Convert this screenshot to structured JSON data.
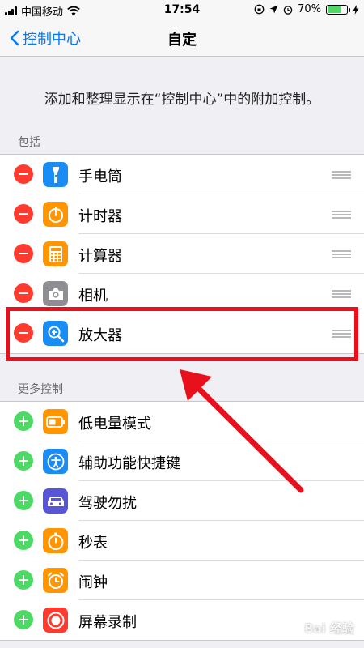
{
  "status_bar": {
    "carrier": "中国移动",
    "time": "17:54",
    "battery_percent": "70%",
    "battery_level": 0.7
  },
  "nav": {
    "back_label": "控制中心",
    "title": "自定"
  },
  "description": "添加和整理显示在“控制中心”中的附加控制。",
  "included": {
    "header": "包括",
    "items": [
      {
        "label": "手电筒",
        "icon": "flashlight-icon",
        "color": "#1a8cf5"
      },
      {
        "label": "计时器",
        "icon": "timer-icon",
        "color": "#ff9500"
      },
      {
        "label": "计算器",
        "icon": "calculator-icon",
        "color": "#ff9500"
      },
      {
        "label": "相机",
        "icon": "camera-icon",
        "color": "#8e8e93"
      },
      {
        "label": "放大器",
        "icon": "magnifier-icon",
        "color": "#1a8cf5"
      }
    ]
  },
  "more_controls": {
    "header": "更多控制",
    "items": [
      {
        "label": "低电量模式",
        "icon": "low-power-mode-icon",
        "color": "#ff9500"
      },
      {
        "label": "辅助功能快捷键",
        "icon": "accessibility-icon",
        "color": "#1a8cf5"
      },
      {
        "label": "驾驶勿扰",
        "icon": "car-icon",
        "color": "#5856d6"
      },
      {
        "label": "秒表",
        "icon": "stopwatch-icon",
        "color": "#ff9500"
      },
      {
        "label": "闹钟",
        "icon": "alarm-icon",
        "color": "#ff9500"
      },
      {
        "label": "屏幕录制",
        "icon": "screen-record-icon",
        "color": "#ff3b30"
      }
    ]
  },
  "colors": {
    "accent": "#007aff",
    "remove": "#ff3b30",
    "add": "#4cd964",
    "highlight": "#e8101d"
  },
  "watermark": "Bai 经验"
}
